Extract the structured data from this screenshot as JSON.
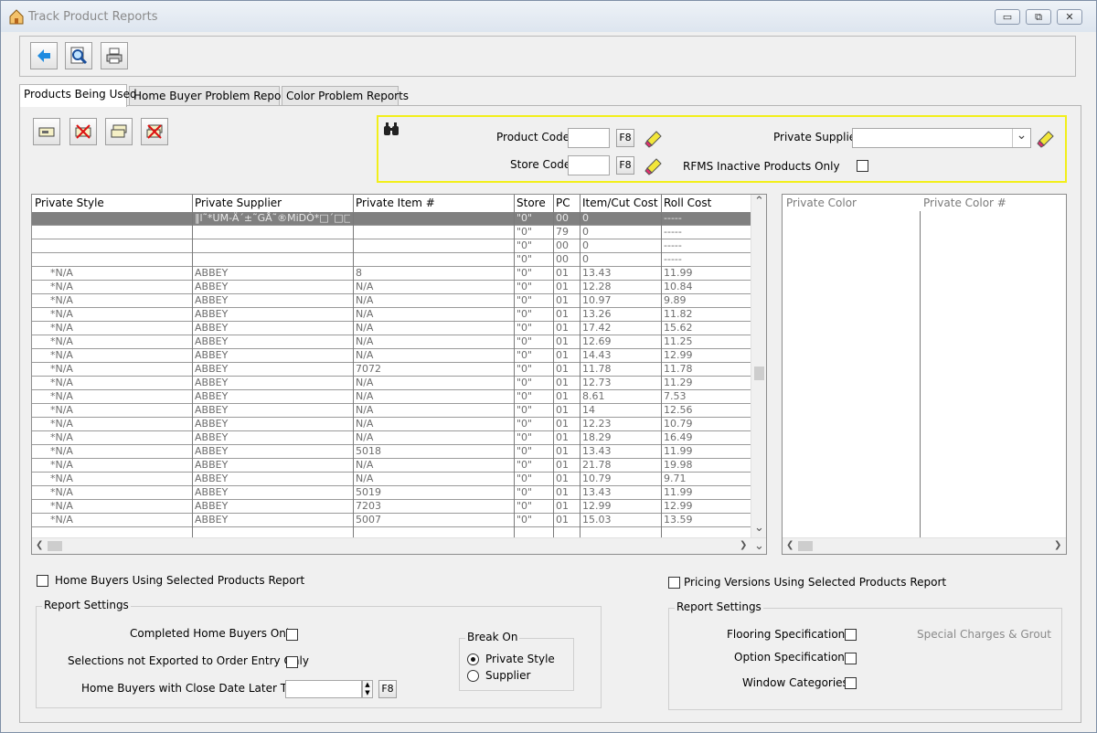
{
  "window": {
    "title": "Track Product Reports",
    "minimize": "▭",
    "restore": "⧉",
    "close": "✕"
  },
  "toolbar": {
    "icons": [
      "back-arrow-icon",
      "preview-magnifier-icon",
      "print-icon"
    ]
  },
  "tabs": [
    "Products Being Used",
    "Home Buyer Problem Reports",
    "Color Problem Reports"
  ],
  "filters": {
    "product_code_label": "Product Code",
    "store_code_label": "Store Code",
    "private_supplier_label": "Private Supplier",
    "inactive_label": "RFMS Inactive Products Only",
    "f8": "F8",
    "supplier_dropdown_arrow": "⌄"
  },
  "grid": {
    "headers": [
      "Private Style",
      "Private Supplier",
      "Private Item #",
      "Store",
      "PC",
      "Item/Cut Cost",
      "Roll Cost"
    ],
    "rows": [
      [
        "",
        "‖l˜*UM-Ä´±˜GÅ˜®MiDÒ*□´□□□ö",
        "",
        "\"0\"",
        "00",
        "0",
        "-----"
      ],
      [
        "",
        "",
        "",
        "\"0\"",
        "79",
        "0",
        "-----"
      ],
      [
        "",
        "",
        "",
        "\"0\"",
        "00",
        "0",
        "-----"
      ],
      [
        "",
        "",
        "",
        "\"0\"",
        "00",
        "0",
        "-----"
      ],
      [
        "*N/A",
        "ABBEY",
        "8",
        "\"0\"",
        "01",
        "13.43",
        "11.99"
      ],
      [
        "*N/A",
        "ABBEY",
        "N/A",
        "\"0\"",
        "01",
        "12.28",
        "10.84"
      ],
      [
        "*N/A",
        "ABBEY",
        "N/A",
        "\"0\"",
        "01",
        "10.97",
        "9.89"
      ],
      [
        "*N/A",
        "ABBEY",
        "N/A",
        "\"0\"",
        "01",
        "13.26",
        "11.82"
      ],
      [
        "*N/A",
        "ABBEY",
        "N/A",
        "\"0\"",
        "01",
        "17.42",
        "15.62"
      ],
      [
        "*N/A",
        "ABBEY",
        "N/A",
        "\"0\"",
        "01",
        "12.69",
        "11.25"
      ],
      [
        "*N/A",
        "ABBEY",
        "N/A",
        "\"0\"",
        "01",
        "14.43",
        "12.99"
      ],
      [
        "*N/A",
        "ABBEY",
        "7072",
        "\"0\"",
        "01",
        "11.78",
        "11.78"
      ],
      [
        "*N/A",
        "ABBEY",
        "N/A",
        "\"0\"",
        "01",
        "12.73",
        "11.29"
      ],
      [
        "*N/A",
        "ABBEY",
        "N/A",
        "\"0\"",
        "01",
        "8.61",
        "7.53"
      ],
      [
        "*N/A",
        "ABBEY",
        "N/A",
        "\"0\"",
        "01",
        "14",
        "12.56"
      ],
      [
        "*N/A",
        "ABBEY",
        "N/A",
        "\"0\"",
        "01",
        "12.23",
        "10.79"
      ],
      [
        "*N/A",
        "ABBEY",
        "N/A",
        "\"0\"",
        "01",
        "18.29",
        "16.49"
      ],
      [
        "*N/A",
        "ABBEY",
        "5018",
        "\"0\"",
        "01",
        "13.43",
        "11.99"
      ],
      [
        "*N/A",
        "ABBEY",
        "N/A",
        "\"0\"",
        "01",
        "21.78",
        "19.98"
      ],
      [
        "*N/A",
        "ABBEY",
        "N/A",
        "\"0\"",
        "01",
        "10.79",
        "9.71"
      ],
      [
        "*N/A",
        "ABBEY",
        "5019",
        "\"0\"",
        "01",
        "13.43",
        "11.99"
      ],
      [
        "*N/A",
        "ABBEY",
        "7203",
        "\"0\"",
        "01",
        "12.99",
        "12.99"
      ],
      [
        "*N/A",
        "ABBEY",
        "5007",
        "\"0\"",
        "01",
        "15.03",
        "13.59"
      ]
    ]
  },
  "color_grid": {
    "headers": [
      "Private Color",
      "Private Color #"
    ]
  },
  "home_buyers": {
    "checkbox_label": "Home Buyers Using Selected Products Report",
    "settings_title": "Report Settings",
    "completed_label": "Completed Home Buyers Only",
    "not_exported_label": "Selections not Exported to Order Entry Only",
    "close_date_label": "Home Buyers with Close Date Later Than",
    "f8": "F8",
    "break_on_title": "Break On",
    "break_on_options": [
      "Private Style",
      "Supplier"
    ]
  },
  "pricing": {
    "checkbox_label": "Pricing Versions Using Selected Products Report",
    "settings_title": "Report Settings",
    "flooring_label": "Flooring Specifications",
    "option_label": "Option Specifications",
    "window_label": "Window Categories",
    "special_label": "Special Charges & Grout"
  },
  "scroll": {
    "left": "❮",
    "right": "❯",
    "up": "⌃",
    "down": "⌄"
  }
}
